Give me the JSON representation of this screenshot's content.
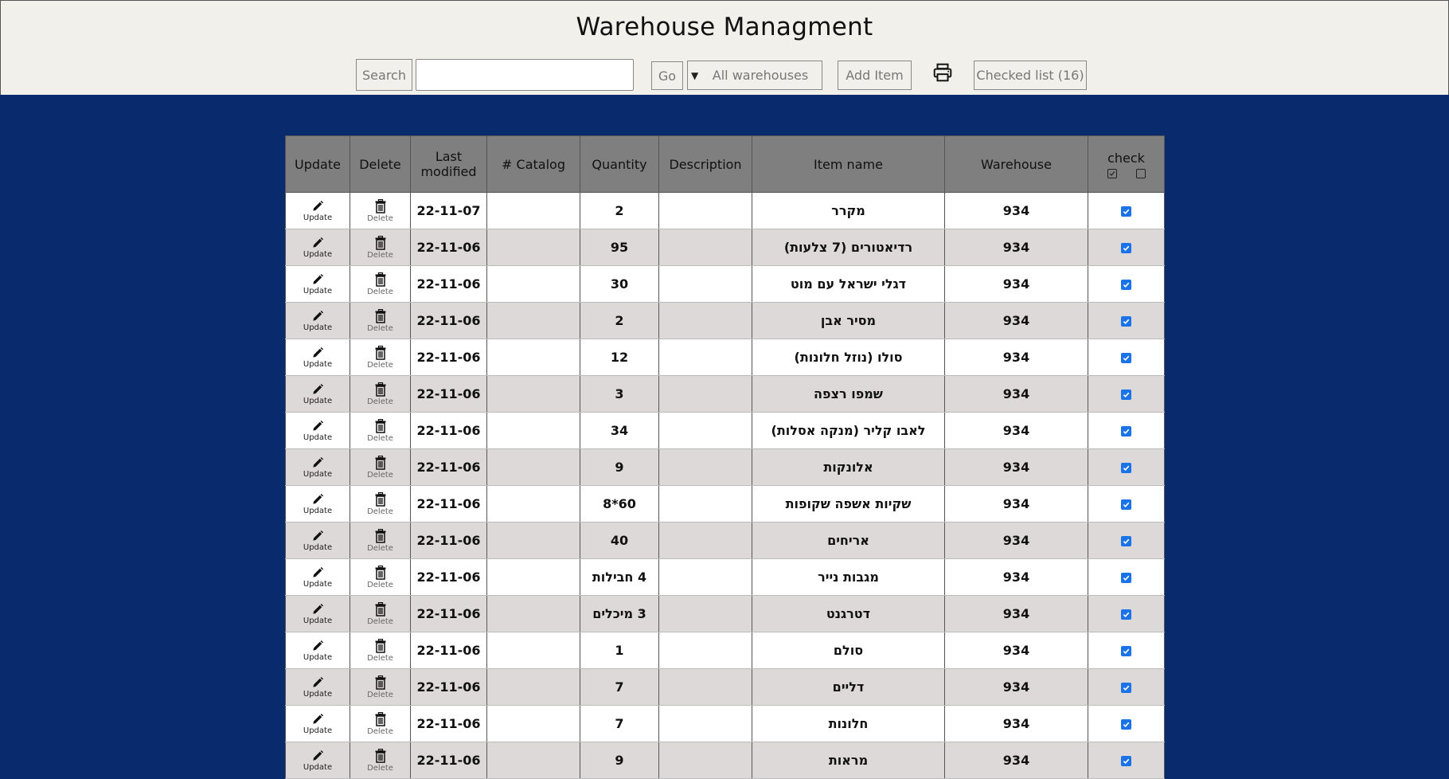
{
  "header": {
    "title": "Warehouse Managment"
  },
  "toolbar": {
    "search_label": "Search",
    "search_value": "",
    "go_label": "Go",
    "warehouse_select": "All warehouses",
    "add_item_label": "Add Item",
    "checked_list_label": "Checked list (16)",
    "print_icon": "printer-icon"
  },
  "table": {
    "columns": [
      "Update",
      "Delete",
      "Last modified",
      "# Catalog",
      "Quantity",
      "Description",
      "Item name",
      "Warehouse",
      "check"
    ],
    "update_label": "Update",
    "delete_label": "Delete",
    "rows": [
      {
        "modified": "22-11-07",
        "catalog": "",
        "quantity": "2",
        "description": "",
        "name": "מקרר",
        "warehouse": "934",
        "checked": true
      },
      {
        "modified": "22-11-06",
        "catalog": "",
        "quantity": "95",
        "description": "",
        "name": "רדיאטורים (7 צלעות)",
        "warehouse": "934",
        "checked": true
      },
      {
        "modified": "22-11-06",
        "catalog": "",
        "quantity": "30",
        "description": "",
        "name": "דגלי ישראל עם מוט",
        "warehouse": "934",
        "checked": true
      },
      {
        "modified": "22-11-06",
        "catalog": "",
        "quantity": "2",
        "description": "",
        "name": "מסיר אבן",
        "warehouse": "934",
        "checked": true
      },
      {
        "modified": "22-11-06",
        "catalog": "",
        "quantity": "12",
        "description": "",
        "name": "סולו (נוזל חלונות)",
        "warehouse": "934",
        "checked": true
      },
      {
        "modified": "22-11-06",
        "catalog": "",
        "quantity": "3",
        "description": "",
        "name": "שמפו רצפה",
        "warehouse": "934",
        "checked": true
      },
      {
        "modified": "22-11-06",
        "catalog": "",
        "quantity": "34",
        "description": "",
        "name": "לאבו קליר (מנקה אסלות)",
        "warehouse": "934",
        "checked": true
      },
      {
        "modified": "22-11-06",
        "catalog": "",
        "quantity": "9",
        "description": "",
        "name": "אלונקות",
        "warehouse": "934",
        "checked": true
      },
      {
        "modified": "22-11-06",
        "catalog": "",
        "quantity": "60*8",
        "description": "",
        "name": "שקיות אשפה שקופות",
        "warehouse": "934",
        "checked": true
      },
      {
        "modified": "22-11-06",
        "catalog": "",
        "quantity": "40",
        "description": "",
        "name": "אריחים",
        "warehouse": "934",
        "checked": true
      },
      {
        "modified": "22-11-06",
        "catalog": "",
        "quantity": "4 חבילות",
        "description": "",
        "name": "מגבות נייר",
        "warehouse": "934",
        "checked": true
      },
      {
        "modified": "22-11-06",
        "catalog": "",
        "quantity": "3 מיכלים",
        "description": "",
        "name": "דטרגנט",
        "warehouse": "934",
        "checked": true
      },
      {
        "modified": "22-11-06",
        "catalog": "",
        "quantity": "1",
        "description": "",
        "name": "סולם",
        "warehouse": "934",
        "checked": true
      },
      {
        "modified": "22-11-06",
        "catalog": "",
        "quantity": "7",
        "description": "",
        "name": "דליים",
        "warehouse": "934",
        "checked": true
      },
      {
        "modified": "22-11-06",
        "catalog": "",
        "quantity": "7",
        "description": "",
        "name": "חלונות",
        "warehouse": "934",
        "checked": true
      },
      {
        "modified": "22-11-06",
        "catalog": "",
        "quantity": "9",
        "description": "",
        "name": "מראות",
        "warehouse": "934",
        "checked": true
      }
    ]
  },
  "colors": {
    "background": "#0a2a6e",
    "bar": "#f1f0ea",
    "header_cell": "#7f7f7f",
    "row_alt": "#dcd9d8",
    "checkbox": "#1a73e8"
  }
}
